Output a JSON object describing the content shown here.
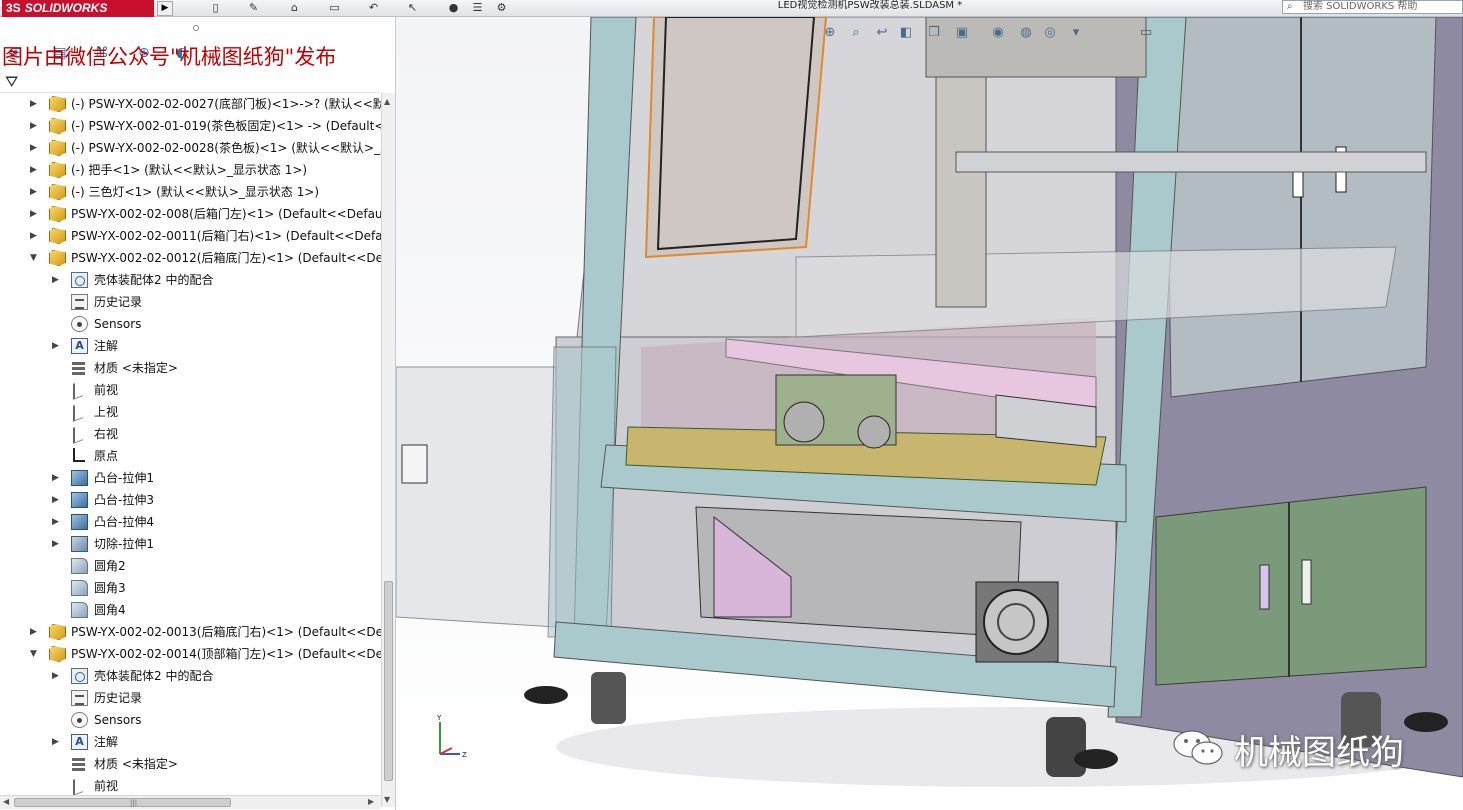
{
  "app": {
    "logo_text": "SOLIDWORKS",
    "logo_prefix": "3S",
    "document_title": "LED视觉检测机PSW改装总装.SLDASM *",
    "search_placeholder": "搜索 SOLIDWORKS 帮助"
  },
  "overlay": {
    "top_watermark": "图片由微信公众号\"机械图纸狗\"发布",
    "bottom_watermark": "机械图纸狗"
  },
  "tree": {
    "rows": [
      {
        "level": 0,
        "expander": "▶",
        "icon": "part",
        "label": "(-) PSW-YX-002-02-0027(底部门板)<1>->? (默认<<默认"
      },
      {
        "level": 0,
        "expander": "▶",
        "icon": "part",
        "label": "(-) PSW-YX-002-01-019(茶色板固定)<1> -> (Default<<"
      },
      {
        "level": 0,
        "expander": "▶",
        "icon": "part",
        "label": "(-) PSW-YX-002-02-0028(茶色板)<1> (默认<<默认>_显"
      },
      {
        "level": 0,
        "expander": "▶",
        "icon": "part",
        "label": "(-) 把手<1> (默认<<默认>_显示状态 1>)"
      },
      {
        "level": 0,
        "expander": "▶",
        "icon": "part",
        "label": "(-) 三色灯<1> (默认<<默认>_显示状态 1>)"
      },
      {
        "level": 0,
        "expander": "▶",
        "icon": "part",
        "label": "PSW-YX-002-02-008(后箱门左)<1> (Default<<Default"
      },
      {
        "level": 0,
        "expander": "▶",
        "icon": "part",
        "label": "PSW-YX-002-02-0011(后箱门右)<1> (Default<<Defaul"
      },
      {
        "level": 0,
        "expander": "▼",
        "icon": "part",
        "label": "PSW-YX-002-02-0012(后箱底门左)<1> (Default<<Defa"
      },
      {
        "level": 1,
        "expander": "▶",
        "icon": "mates",
        "label": "壳体装配体2 中的配合"
      },
      {
        "level": 1,
        "expander": "",
        "icon": "history",
        "label": "历史记录"
      },
      {
        "level": 1,
        "expander": "",
        "icon": "sensor",
        "label": "Sensors"
      },
      {
        "level": 1,
        "expander": "▶",
        "icon": "annot",
        "label": "注解"
      },
      {
        "level": 1,
        "expander": "",
        "icon": "material",
        "label": "材质 <未指定>"
      },
      {
        "level": 1,
        "expander": "",
        "icon": "plane",
        "label": "前视"
      },
      {
        "level": 1,
        "expander": "",
        "icon": "plane",
        "label": "上视"
      },
      {
        "level": 1,
        "expander": "",
        "icon": "plane",
        "label": "右视"
      },
      {
        "level": 1,
        "expander": "",
        "icon": "origin",
        "label": "原点"
      },
      {
        "level": 1,
        "expander": "▶",
        "icon": "feature",
        "label": "凸台-拉伸1"
      },
      {
        "level": 1,
        "expander": "▶",
        "icon": "feature",
        "label": "凸台-拉伸3"
      },
      {
        "level": 1,
        "expander": "▶",
        "icon": "feature",
        "label": "凸台-拉伸4"
      },
      {
        "level": 1,
        "expander": "▶",
        "icon": "cut",
        "label": "切除-拉伸1"
      },
      {
        "level": 1,
        "expander": "",
        "icon": "fillet",
        "label": "圆角2"
      },
      {
        "level": 1,
        "expander": "",
        "icon": "fillet",
        "label": "圆角3"
      },
      {
        "level": 1,
        "expander": "",
        "icon": "fillet",
        "label": "圆角4"
      },
      {
        "level": 0,
        "expander": "▶",
        "icon": "part",
        "label": "PSW-YX-002-02-0013(后箱底门右)<1> (Default<<Defa"
      },
      {
        "level": 0,
        "expander": "▼",
        "icon": "part",
        "label": "PSW-YX-002-02-0014(顶部箱门左)<1> (Default<<Defa"
      },
      {
        "level": 1,
        "expander": "▶",
        "icon": "mates",
        "label": "壳体装配体2 中的配合"
      },
      {
        "level": 1,
        "expander": "",
        "icon": "history",
        "label": "历史记录"
      },
      {
        "level": 1,
        "expander": "",
        "icon": "sensor",
        "label": "Sensors"
      },
      {
        "level": 1,
        "expander": "▶",
        "icon": "annot",
        "label": "注解"
      },
      {
        "level": 1,
        "expander": "",
        "icon": "material",
        "label": "材质 <未指定>"
      },
      {
        "level": 1,
        "expander": "",
        "icon": "plane",
        "label": "前视"
      }
    ]
  },
  "triad": {
    "y": "Y",
    "z": "Z"
  },
  "colors": {
    "frame": "#a9c9cc",
    "cabinet": "#8c8aa3",
    "door": "#7f9a7c",
    "logo_red": "#c8102e"
  }
}
